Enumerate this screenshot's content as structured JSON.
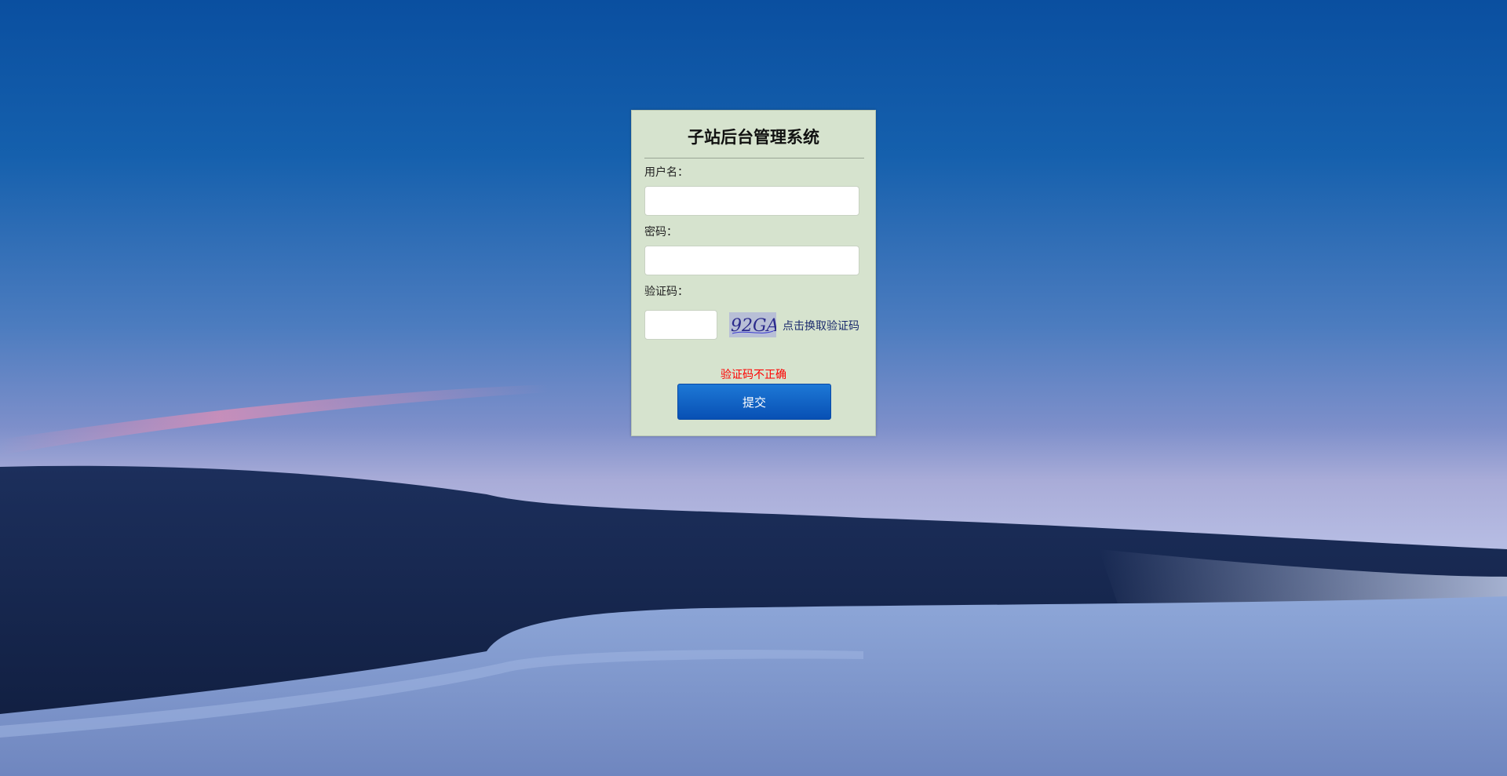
{
  "login": {
    "title": "子站后台管理系统",
    "username_label": "用户名：",
    "username_value": "",
    "password_label": "密码：",
    "password_value": "",
    "captcha_label": "验证码：",
    "captcha_value": "",
    "captcha_image_text": "92GA",
    "captcha_refresh_label": "点击换取验证码",
    "error_message": "验证码不正确",
    "submit_label": "提交"
  },
  "colors": {
    "panel_background": "#d6e3ce",
    "error_text": "#ff0000",
    "submit_button": "#0a5cc4",
    "refresh_link": "#1a2a6c"
  },
  "icons": {
    "captcha": "captcha-image"
  }
}
